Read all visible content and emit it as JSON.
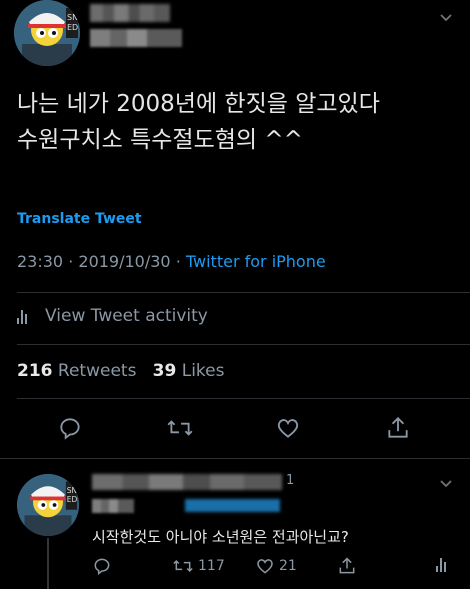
{
  "tweet": {
    "text_line1": "나는 네가 2008년에 한짓을 알고있다",
    "text_line2": "수원구치소 특수절도혐의 ^^",
    "translate_label": "Translate Tweet",
    "time": "23:30",
    "date": "2019/10/30",
    "separator": "·",
    "source": "Twitter for iPhone",
    "activity_label": "View Tweet activity",
    "retweets_count": "216",
    "retweets_label": "Retweets",
    "likes_count": "39",
    "likes_label": "Likes"
  },
  "reply": {
    "text": "시작한것도 아니야 소년원은 전과아닌교?",
    "retweet_count": "117",
    "like_count": "21",
    "name_fragment": "1"
  },
  "colors": {
    "background": "#000000",
    "link": "#1d9bf0",
    "muted": "#8b98a5"
  }
}
